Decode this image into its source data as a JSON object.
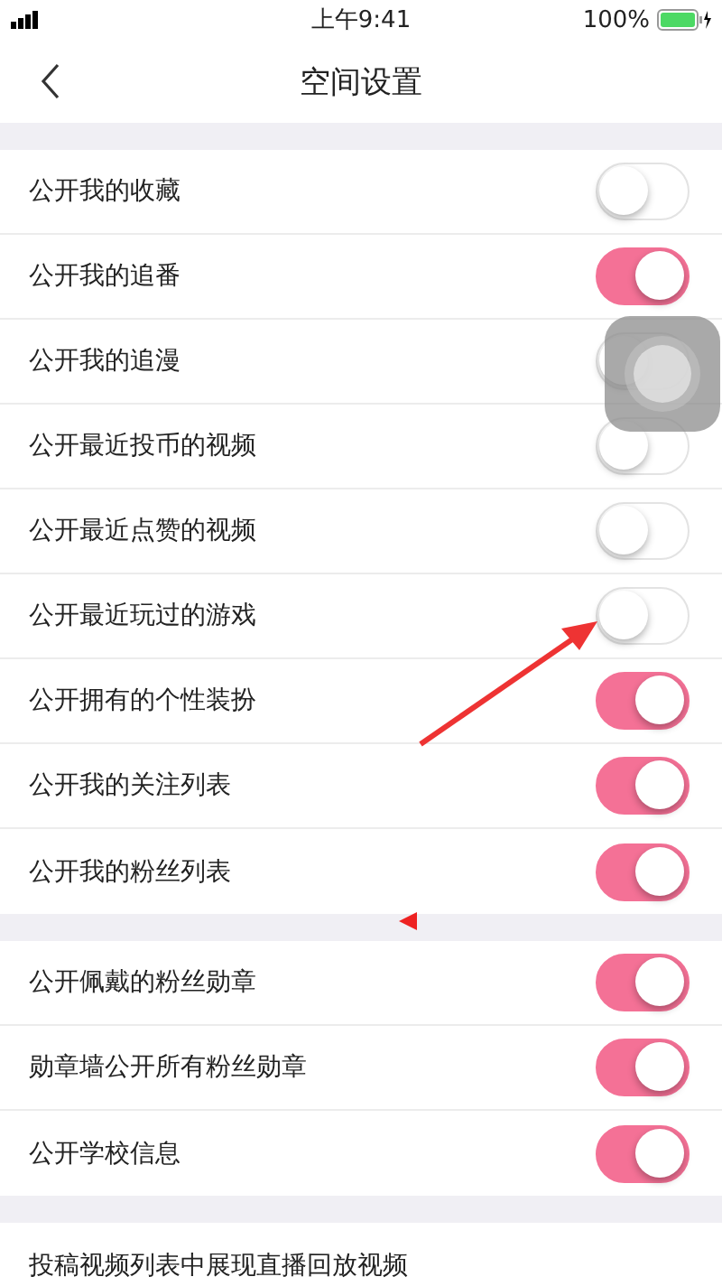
{
  "status_bar": {
    "time": "上午9:41",
    "battery": "100%"
  },
  "nav": {
    "title": "空间设置"
  },
  "sections": [
    {
      "rows": [
        {
          "kind": "toggle",
          "label": "公开我的收藏",
          "on": false
        },
        {
          "kind": "toggle",
          "label": "公开我的追番",
          "on": true
        },
        {
          "kind": "toggle",
          "label": "公开我的追漫",
          "on": false
        },
        {
          "kind": "toggle",
          "label": "公开最近投币的视频",
          "on": false
        },
        {
          "kind": "toggle",
          "label": "公开最近点赞的视频",
          "on": false
        },
        {
          "kind": "toggle",
          "label": "公开最近玩过的游戏",
          "on": false
        },
        {
          "kind": "toggle",
          "label": "公开拥有的个性装扮",
          "on": true
        },
        {
          "kind": "toggle",
          "label": "公开我的关注列表",
          "on": true
        },
        {
          "kind": "toggle",
          "label": "公开我的粉丝列表",
          "on": true
        }
      ]
    },
    {
      "rows": [
        {
          "kind": "toggle",
          "label": "公开佩戴的粉丝勋章",
          "on": true
        },
        {
          "kind": "toggle",
          "label": "勋章墙公开所有粉丝勋章",
          "on": true
        },
        {
          "kind": "toggle",
          "label": "公开学校信息",
          "on": true
        }
      ]
    },
    {
      "rows": [
        {
          "kind": "text",
          "label": "投稿视频列表中展现直播回放视频"
        }
      ]
    }
  ]
}
